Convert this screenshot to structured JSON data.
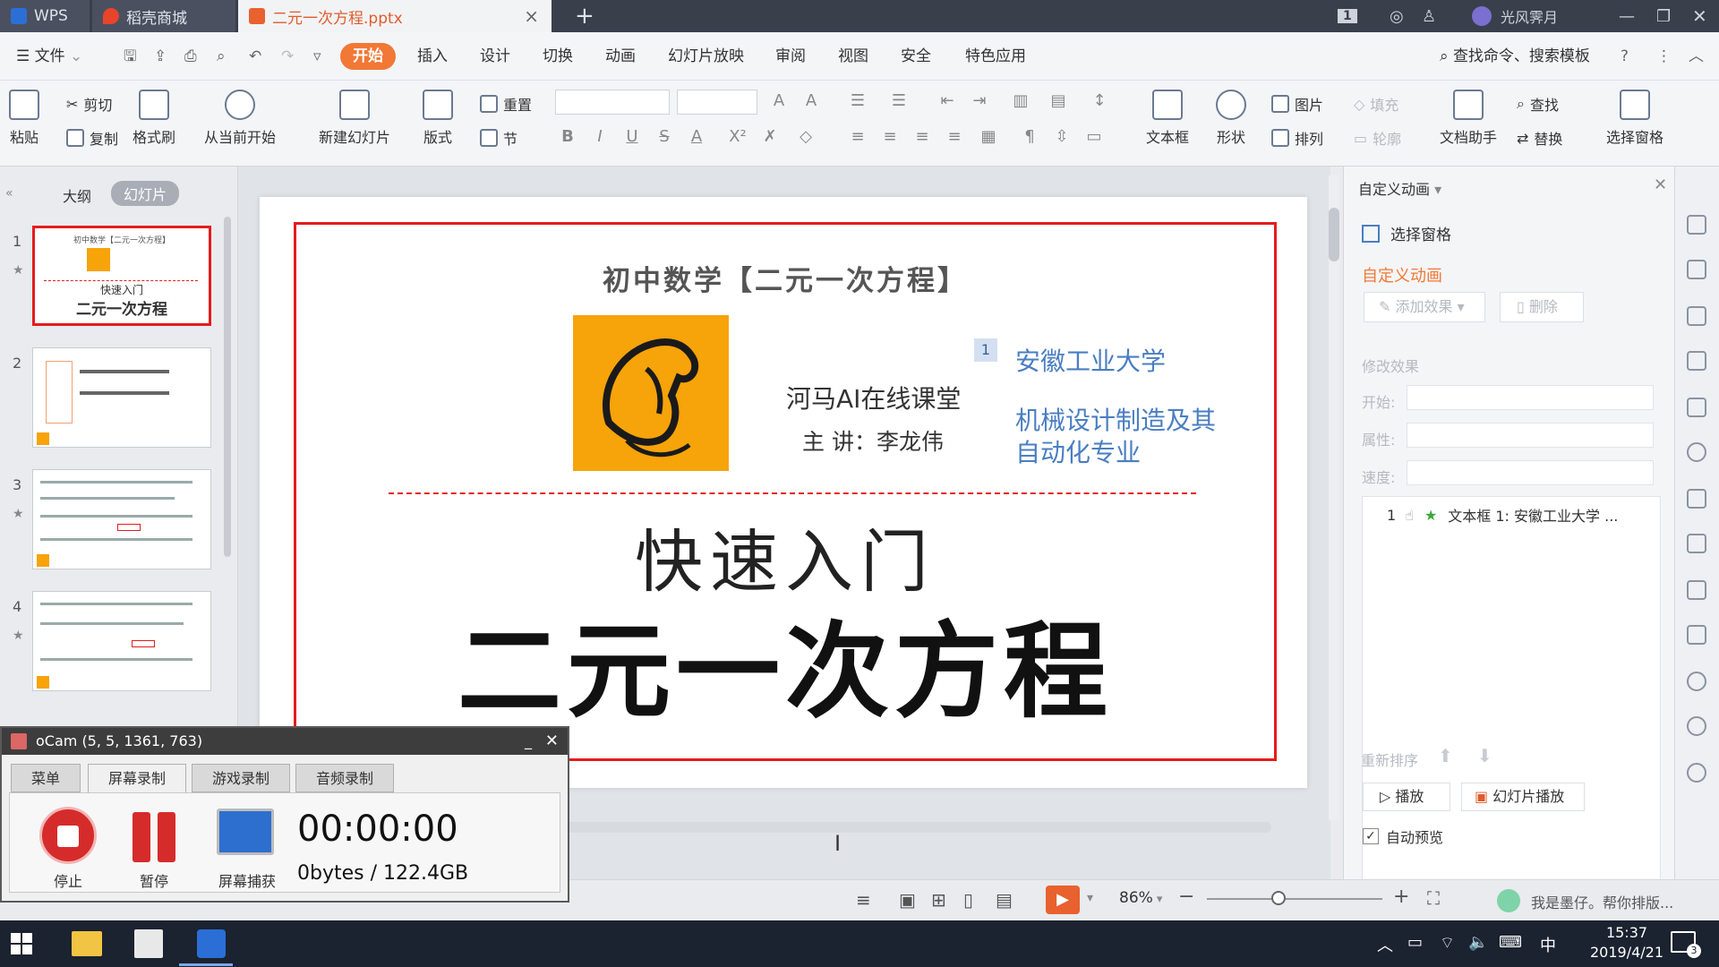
{
  "titlebar": {
    "wps_tab": "WPS",
    "shop_tab": "稻壳商城",
    "file_tab": "二元一次方程.pptx",
    "page_badge": "1",
    "username": "光风霁月"
  },
  "menu": {
    "file": "文件",
    "tabs": [
      "开始",
      "插入",
      "设计",
      "切换",
      "动画",
      "幻灯片放映",
      "审阅",
      "视图",
      "安全",
      "特色应用"
    ],
    "search": "查找命令、搜索模板"
  },
  "ribbon": {
    "paste": "粘贴",
    "cut": "剪切",
    "copy": "复制",
    "format_painter": "格式刷",
    "from_current": "从当前开始",
    "new_slide": "新建幻灯片",
    "layout": "版式",
    "reset": "重置",
    "section": "节",
    "textbox": "文本框",
    "shape": "形状",
    "picture": "图片",
    "fill": "填充",
    "arrange": "排列",
    "outline": "轮廓",
    "doc_assistant": "文档助手",
    "find": "查找",
    "replace": "替换",
    "select_pane": "选择窗格"
  },
  "leftpanel": {
    "outline_tab": "大纲",
    "slides_tab": "幻灯片",
    "thumbs": [
      {
        "num": "1",
        "title_small": "初中数学【二元一次方程】",
        "line1": "快速入门",
        "line2": "二元一次方程"
      },
      {
        "num": "2"
      },
      {
        "num": "3"
      },
      {
        "num": "4"
      }
    ]
  },
  "slide": {
    "header": "初中数学【二元一次方程】",
    "org": "河马AI在线课堂",
    "lecturer": "主 讲：李龙伟",
    "anim_tag": "1",
    "university": "安徽工业大学",
    "major": "机械设计制造及其自动化专业",
    "subtitle": "快速入门",
    "title": "二元一次方程"
  },
  "rightpane": {
    "title": "自定义动画",
    "select_pane": "选择窗格",
    "section_title": "自定义动画",
    "add_effect": "添加效果",
    "delete": "删除",
    "modify": "修改效果",
    "start_label": "开始:",
    "property_label": "属性:",
    "speed_label": "速度:",
    "anim_item_num": "1",
    "anim_item": "文本框 1: 安徽工业大学 ...",
    "reorder": "重新排序",
    "play": "播放",
    "slideshow": "幻灯片播放",
    "auto_preview": "自动预览"
  },
  "statusbar": {
    "zoom": "86%",
    "assistant": "我是墨仔。帮你排版..."
  },
  "ocam": {
    "title": "oCam (5, 5, 1361, 763)",
    "tabs": [
      "菜单",
      "屏幕录制",
      "游戏录制",
      "音频录制"
    ],
    "stop": "停止",
    "pause": "暂停",
    "capture": "屏幕捕获",
    "timer": "00:00:00",
    "size": "0bytes / 122.4GB"
  },
  "taskbar": {
    "ime": "中",
    "time": "15:37",
    "date": "2019/4/21",
    "notif": "3"
  },
  "colors": {
    "accent": "#f27836",
    "slide_border": "#e41c1c",
    "blue_text": "#4a7ec2",
    "logo_bg": "#f7a30a"
  }
}
